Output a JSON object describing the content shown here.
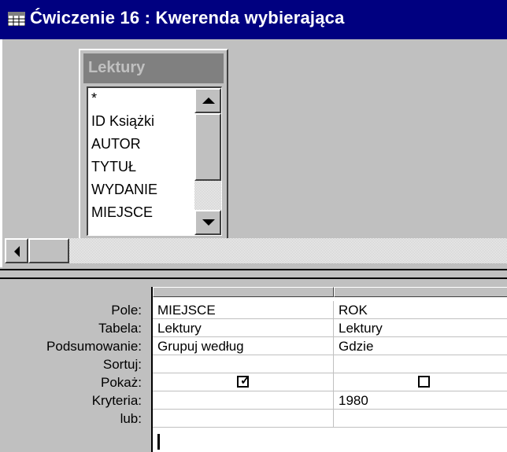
{
  "window": {
    "title": "Ćwiczenie 16 : Kwerenda wybierająca",
    "icon": "query-icon"
  },
  "table_box": {
    "title": "Lektury",
    "fields": [
      "*",
      "ID Książki",
      "AUTOR",
      "TYTUŁ",
      "WYDANIE",
      "MIEJSCE"
    ]
  },
  "grid": {
    "row_labels": [
      "Pole:",
      "Tabela:",
      "Podsumowanie:",
      "Sortuj:",
      "Pokaż:",
      "Kryteria:",
      "lub:"
    ],
    "columns": [
      {
        "pole": "MIEJSCE",
        "tabela": "Lektury",
        "podsumowanie": "Grupuj według",
        "sortuj": "",
        "pokaz": true,
        "kryteria": "",
        "lub": ""
      },
      {
        "pole": "ROK",
        "tabela": "Lektury",
        "podsumowanie": "Gdzie",
        "sortuj": "",
        "pokaz": false,
        "kryteria": "1980",
        "lub": ""
      }
    ]
  },
  "colors": {
    "titlebar": "#000080",
    "face": "#c0c0c0"
  }
}
